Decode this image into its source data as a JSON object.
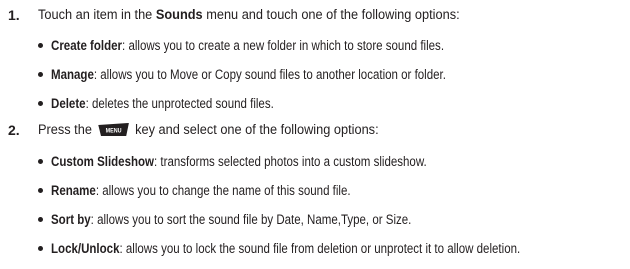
{
  "steps": [
    {
      "number": "1.",
      "pre": "Touch an item in the ",
      "bold": "Sounds",
      "post": " menu and touch one of the following options:",
      "options": [
        {
          "term": "Create folder",
          "desc": ": allows you to create a new folder in which to store sound files."
        },
        {
          "term": "Manage",
          "desc": ": allows you to Move or Copy sound files to another location or folder."
        },
        {
          "term": "Delete",
          "desc": ": deletes the unprotected sound files."
        }
      ]
    },
    {
      "number": "2.",
      "pre": "Press the",
      "key_label": "MENU",
      "post": "key and select one of the following options:",
      "options": [
        {
          "term": "Custom Slideshow",
          "desc": ": transforms selected photos into a custom slideshow."
        },
        {
          "term": "Rename",
          "desc": ": allows you to change the name of this sound file."
        },
        {
          "term": "Sort by",
          "desc": ": allows you to sort the sound file by Date, Name,Type, or Size."
        },
        {
          "term": "Lock/Unlock",
          "desc": ": allows you to lock the sound file from deletion or unprotect it to allow deletion."
        }
      ]
    }
  ],
  "colors": {
    "text": "#231f20",
    "key_fill": "#231f20",
    "key_label": "#ffffff"
  }
}
